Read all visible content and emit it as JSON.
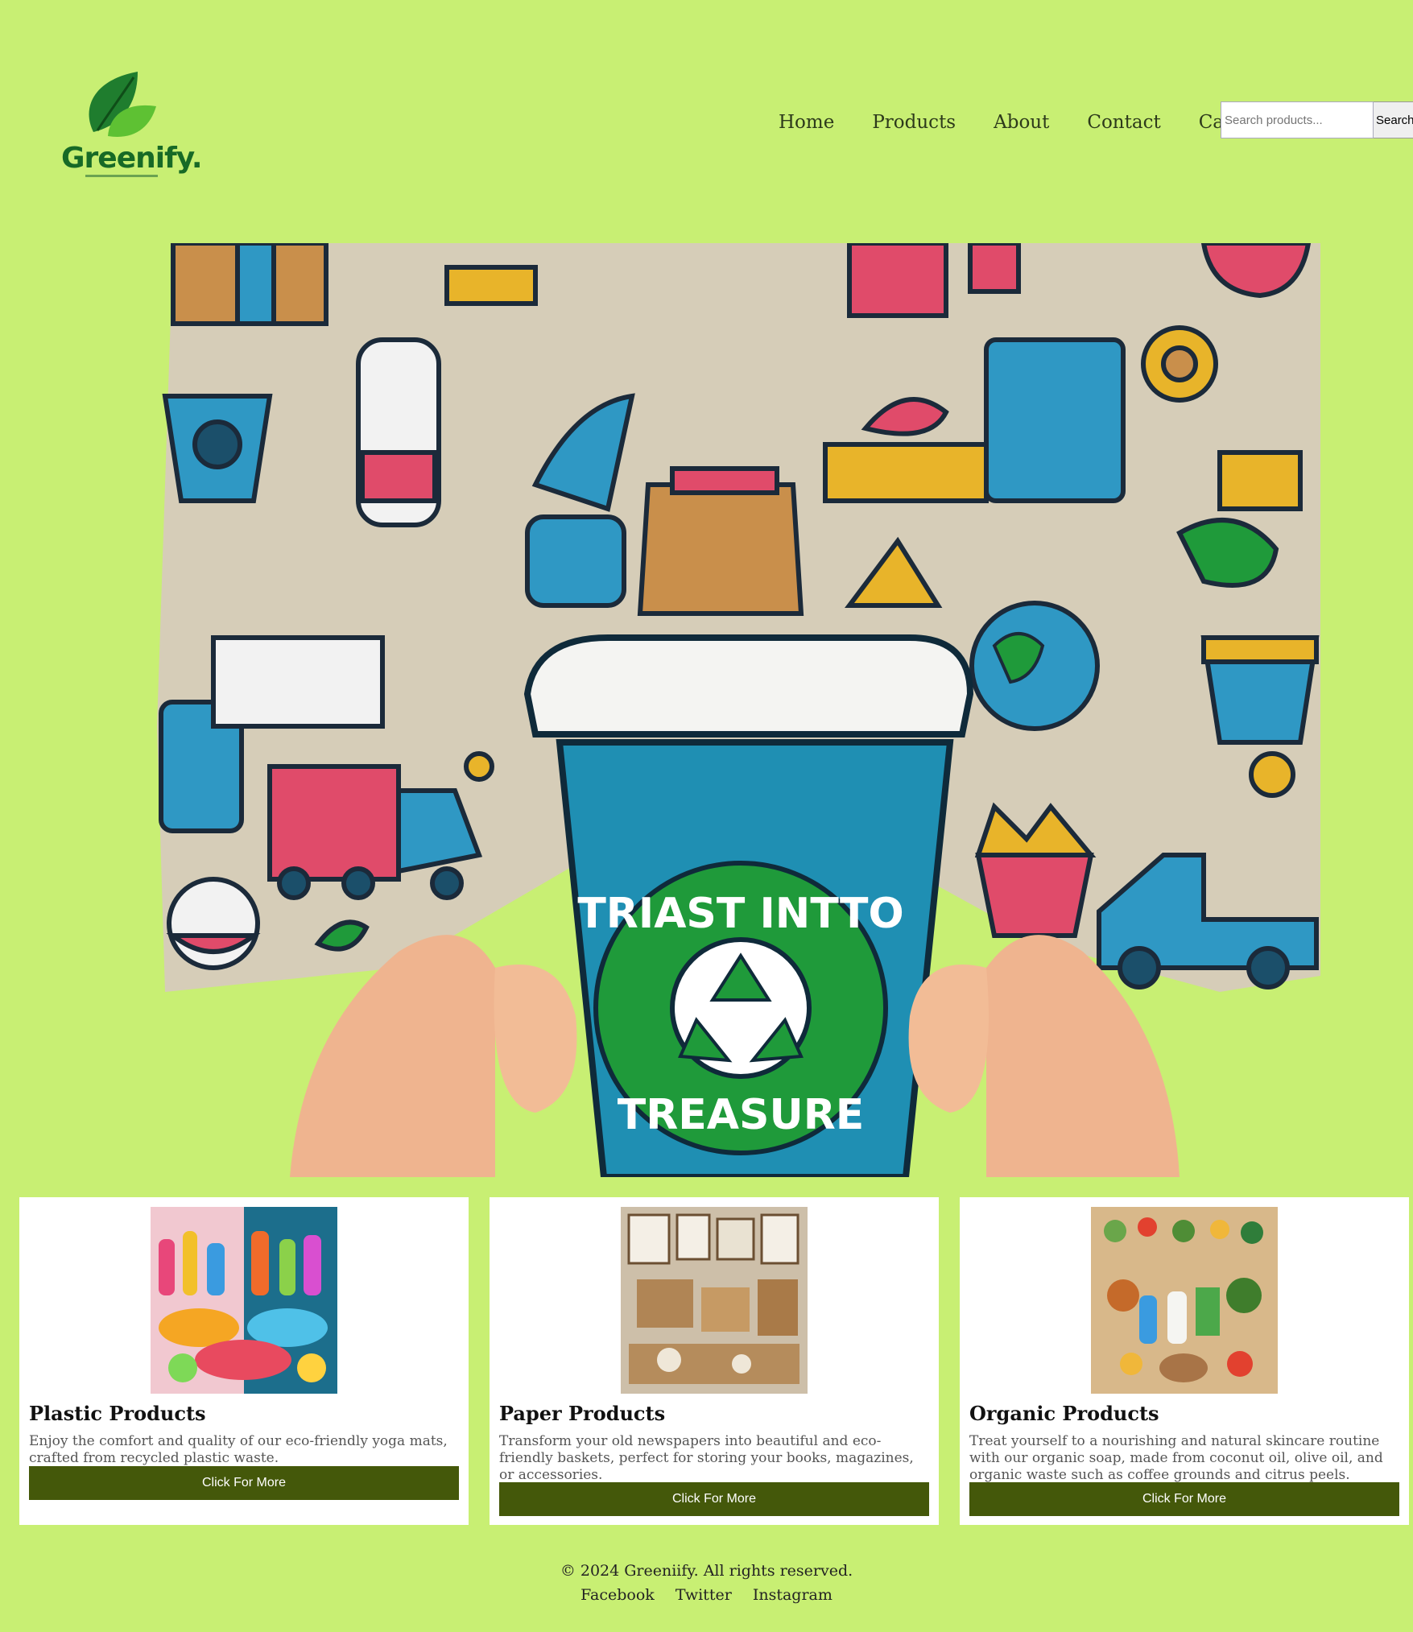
{
  "brand": {
    "name": "Greenify.",
    "tagline": ""
  },
  "nav": {
    "items": [
      {
        "label": "Home"
      },
      {
        "label": "Products"
      },
      {
        "label": "About"
      },
      {
        "label": "Contact"
      },
      {
        "label": "Cart"
      }
    ]
  },
  "search": {
    "placeholder": "Search products...",
    "button_label": "Search"
  },
  "hero": {
    "badge_top": "TRIAST INTTO",
    "badge_bottom": "TREASURE"
  },
  "cards": [
    {
      "title": "Plastic Products",
      "description": "Enjoy the comfort and quality of our eco-friendly yoga mats, crafted from recycled plastic waste.",
      "button_label": "Click For More"
    },
    {
      "title": "Paper Products",
      "description": "Transform your old newspapers into beautiful and eco-friendly baskets, perfect for storing your books, magazines, or accessories.",
      "button_label": "Click For More"
    },
    {
      "title": "Organic Products",
      "description": "Treat yourself to a nourishing and natural skincare routine with our organic soap, made from coconut oil, olive oil, and organic waste such as coffee grounds and citrus peels.",
      "button_label": "Click For More"
    }
  ],
  "footer": {
    "copyright": "© 2024 Greeniify. All rights reserved.",
    "links": [
      {
        "label": "Facebook"
      },
      {
        "label": "Twitter"
      },
      {
        "label": "Instagram"
      }
    ]
  },
  "colors": {
    "background": "#c8ef73",
    "button": "#44580a",
    "brand_green": "#176a26"
  }
}
